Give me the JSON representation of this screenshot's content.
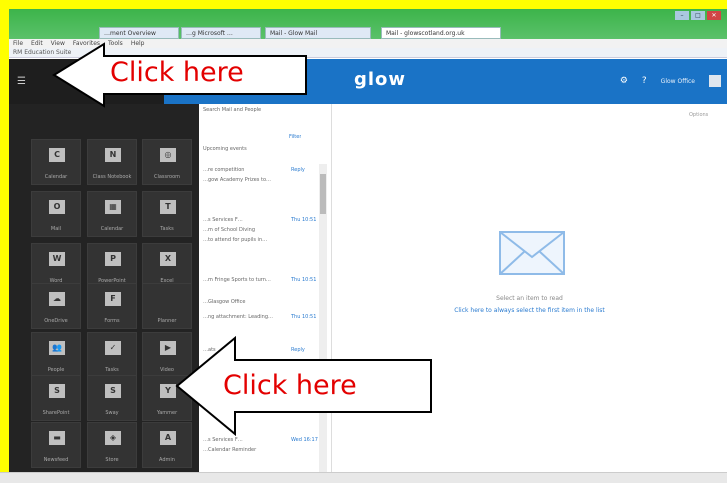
{
  "browser": {
    "tabs": [
      "…ment Overview",
      "…g Microsoft …",
      "Mail - Glow Mail",
      "Mail - glowscotland.org.uk"
    ],
    "menu": [
      "File",
      "Edit",
      "View",
      "Favorites",
      "Tools",
      "Help"
    ],
    "favorites": "RM Education Suite",
    "window_controls": [
      "–",
      "□",
      "✕"
    ]
  },
  "app": {
    "logo": "glow",
    "user_label": "Glow Office",
    "top_link": "Options"
  },
  "launcher": {
    "tiles": [
      {
        "label": "Calendar",
        "icon": "calendar-icon",
        "glyph": "C"
      },
      {
        "label": "Class Notebook",
        "icon": "onenote-class-icon",
        "glyph": "N"
      },
      {
        "label": "Classroom",
        "icon": "classroom-icon",
        "glyph": "◎"
      },
      {
        "label": "Mail",
        "icon": "outlook-icon",
        "glyph": "O"
      },
      {
        "label": "Calendar",
        "icon": "calendar-icon",
        "glyph": "▦"
      },
      {
        "label": "Tasks",
        "icon": "tasks-icon",
        "glyph": "T"
      },
      {
        "label": "Word",
        "icon": "word-icon",
        "glyph": "W"
      },
      {
        "label": "PowerPoint",
        "icon": "powerpoint-icon",
        "glyph": "P"
      },
      {
        "label": "Excel",
        "icon": "excel-icon",
        "glyph": "X"
      },
      {
        "label": "OneDrive",
        "icon": "onedrive-icon",
        "glyph": "☁"
      },
      {
        "label": "Forms",
        "icon": "forms-icon",
        "glyph": "F"
      },
      {
        "label": "Planner",
        "icon": "planner-icon",
        "glyph": ""
      },
      {
        "label": "People",
        "icon": "people-icon",
        "glyph": "👥"
      },
      {
        "label": "Tasks",
        "icon": "tasks-check-icon",
        "glyph": "✓"
      },
      {
        "label": "Video",
        "icon": "video-icon",
        "glyph": "▶"
      },
      {
        "label": "SharePoint",
        "icon": "sharepoint-icon",
        "glyph": "S"
      },
      {
        "label": "Sway",
        "icon": "sway-icon",
        "glyph": "S"
      },
      {
        "label": "Yammer",
        "icon": "yammer-icon",
        "glyph": "Y"
      },
      {
        "label": "Newsfeed",
        "icon": "newsfeed-icon",
        "glyph": "▬"
      },
      {
        "label": "Store",
        "icon": "store-icon",
        "glyph": "◈"
      },
      {
        "label": "Admin",
        "icon": "admin-icon",
        "glyph": "A"
      }
    ]
  },
  "mail_list": {
    "header": "Search Mail and People",
    "filter": "Filter",
    "items": [
      {
        "line1": "Upcoming events",
        "line2": ""
      },
      {
        "line1": "…re competition",
        "line2": "Reply"
      },
      {
        "line1": "…gow Academy Prizes to…",
        "line2": ""
      },
      {
        "line1": "…s Services F…",
        "line2": "Thu 10:51"
      },
      {
        "line1": "…m of School Diving",
        "line2": ""
      },
      {
        "line1": "…to attend for pupils in…",
        "line2": ""
      },
      {
        "line1": "…m Fringe Sports to turn…",
        "line2": "Thu 10:51"
      },
      {
        "line1": "…Glasgow Office",
        "line2": ""
      },
      {
        "line1": "…ng attachment: Leading…",
        "line2": "Thu 10:51"
      },
      {
        "line1": "…ats",
        "line2": "Reply"
      },
      {
        "line1": "…s Services F…",
        "line2": "Wed 16:17"
      },
      {
        "line1": "…Calendar Reminder",
        "line2": ""
      }
    ]
  },
  "reading_pane": {
    "empty_title": "Select an item to read",
    "empty_link": "Click here to always select the first item in the list"
  },
  "callouts": {
    "top": "Click here",
    "bottom": "Click here"
  }
}
